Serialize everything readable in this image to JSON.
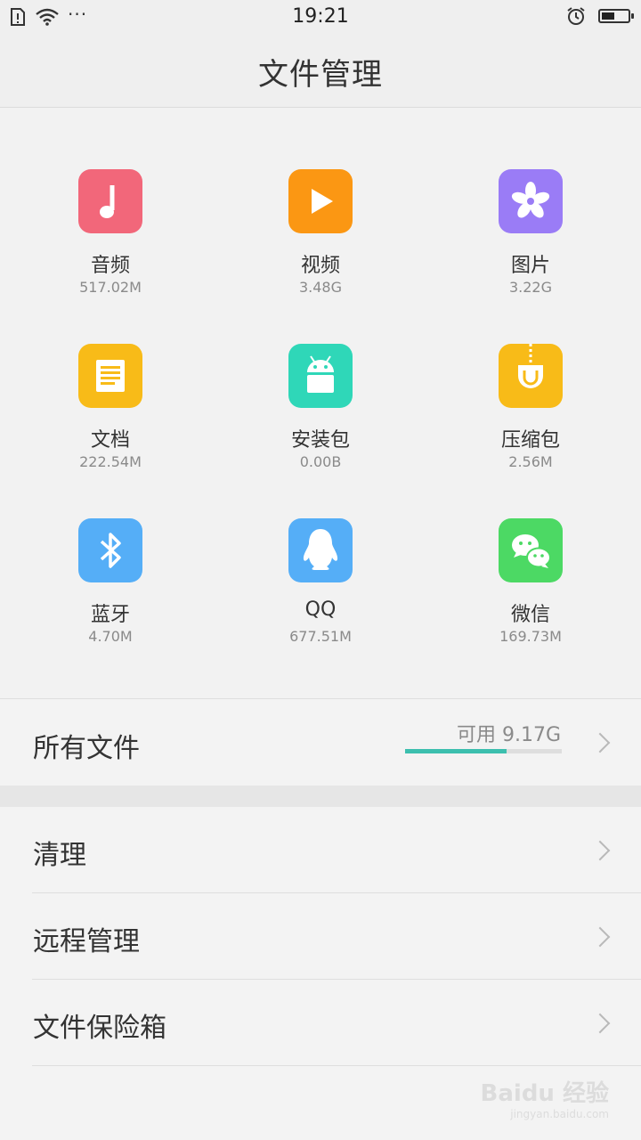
{
  "status_bar": {
    "time": "19:21",
    "more": "···"
  },
  "header": {
    "title": "文件管理"
  },
  "categories": [
    {
      "name": "音频",
      "size": "517.02M",
      "icon": "music-note-icon",
      "color": "#f2677a"
    },
    {
      "name": "视频",
      "size": "3.48G",
      "icon": "play-icon",
      "color": "#fb9713"
    },
    {
      "name": "图片",
      "size": "3.22G",
      "icon": "flower-icon",
      "color": "#9a7cf6"
    },
    {
      "name": "文档",
      "size": "222.54M",
      "icon": "document-icon",
      "color": "#f8bb18"
    },
    {
      "name": "安装包",
      "size": "0.00B",
      "icon": "android-icon",
      "color": "#2fd7b8"
    },
    {
      "name": "压缩包",
      "size": "2.56M",
      "icon": "zip-icon",
      "color": "#f8bb18"
    },
    {
      "name": "蓝牙",
      "size": "4.70M",
      "icon": "bluetooth-icon",
      "color": "#55aef7"
    },
    {
      "name": "QQ",
      "size": "677.51M",
      "icon": "qq-penguin-icon",
      "color": "#55aef7"
    },
    {
      "name": "微信",
      "size": "169.73M",
      "icon": "wechat-icon",
      "color": "#4cd964"
    }
  ],
  "all_files": {
    "label": "所有文件",
    "available": "可用 9.17G",
    "used_fraction": 0.65,
    "bar_color": "#3cbfae"
  },
  "menu": [
    {
      "label": "清理"
    },
    {
      "label": "远程管理"
    },
    {
      "label": "文件保险箱"
    }
  ],
  "watermark": {
    "brand": "Baidu 经验",
    "site": "jingyan.baidu.com"
  }
}
